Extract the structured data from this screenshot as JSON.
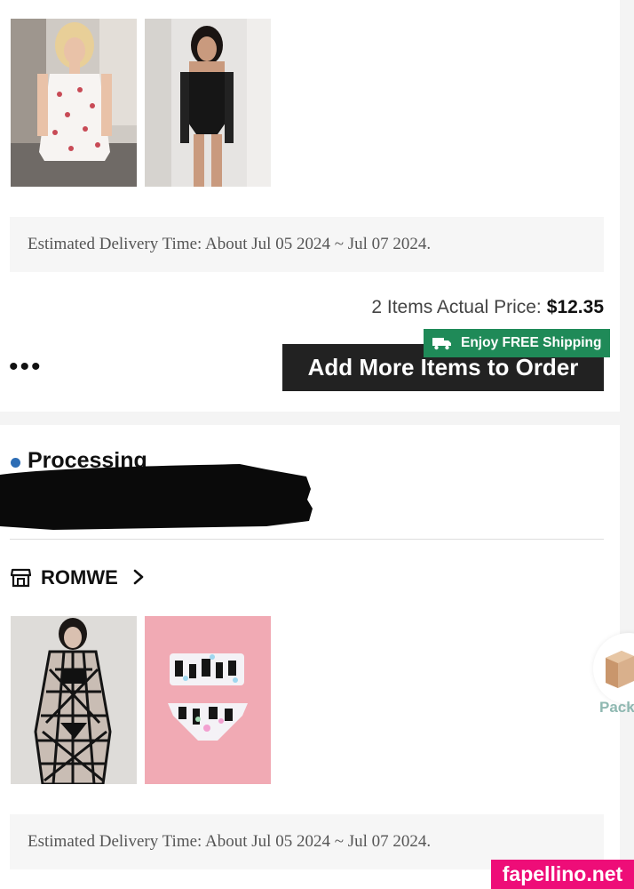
{
  "order_top": {
    "delivery_text": "Estimated Delivery Time: About Jul 05 2024 ~ Jul 07 2024.",
    "actual_price_label": "2 Items Actual Price:",
    "actual_price_value": "$12.35",
    "more_dots": "•••",
    "add_more_button": "Add More Items to Order",
    "free_shipping_badge": "Enjoy FREE Shipping",
    "products": [
      {
        "name": "product-thumb-white-cherry-dress"
      },
      {
        "name": "product-thumb-black-fishnet-bodysuit"
      }
    ]
  },
  "order_bottom": {
    "status": "Processing",
    "store_name": "ROMWE",
    "delivery_text": "Estimated Delivery Time: About Jul 05 2024 ~ Jul 07 2024.",
    "products": [
      {
        "name": "product-thumb-black-web-dress"
      },
      {
        "name": "product-thumb-pink-print-bikini"
      }
    ]
  },
  "package_widget": {
    "label": "Pack",
    "icon": "package-box-icon"
  },
  "watermark": "fapellino.net",
  "colors": {
    "badge_green": "#1f8a58",
    "button_dark": "#222222",
    "status_blue": "#2d6db5",
    "watermark_pink": "#ee0d78",
    "pack_label": "#8fb8b1"
  }
}
